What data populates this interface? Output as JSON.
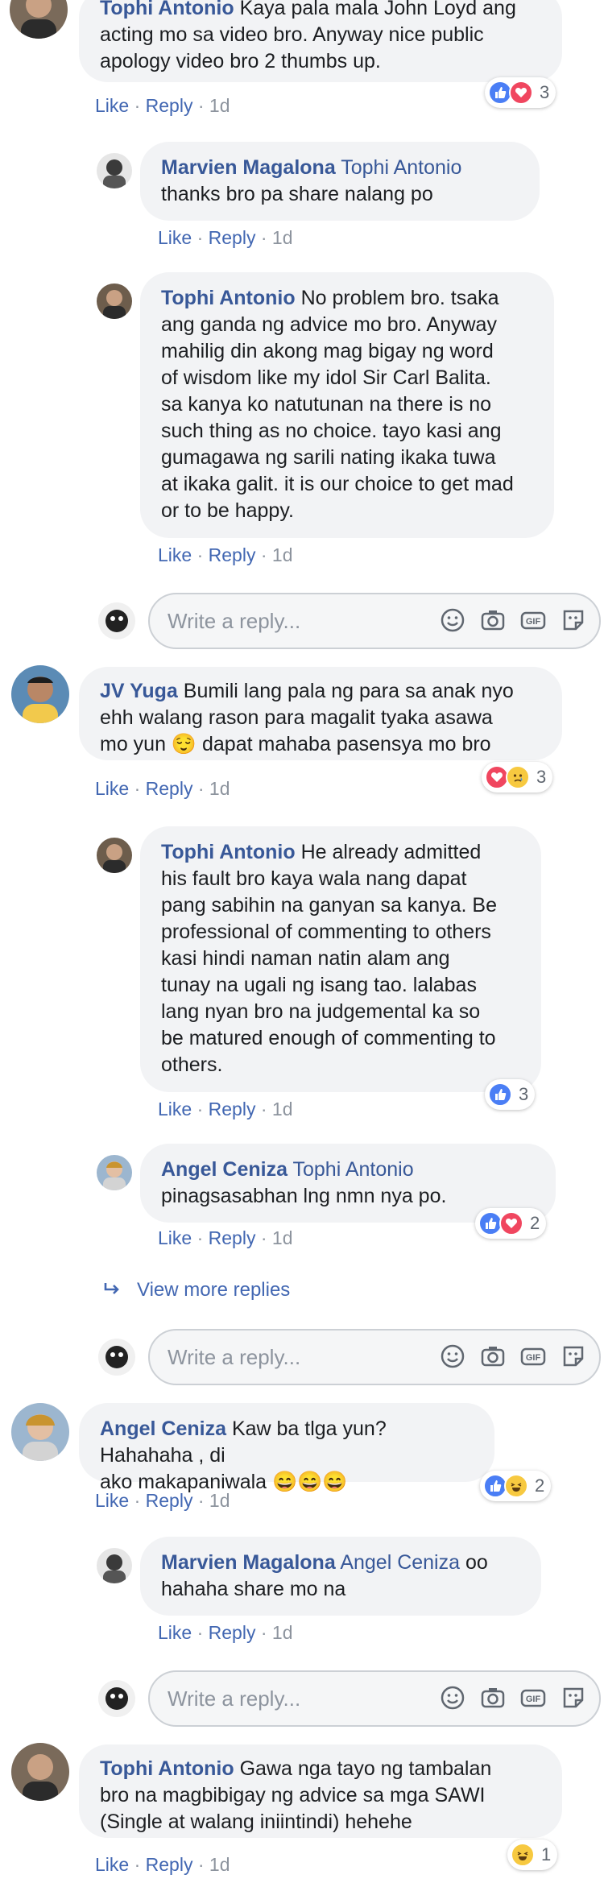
{
  "action_labels": {
    "like": "Like",
    "reply": "Reply",
    "sep": " · "
  },
  "reply_placeholder": "Write a reply...",
  "view_more_label": "View more replies",
  "comments": [
    {
      "name": "Tophi Antonio",
      "tag": "",
      "lines": [
        "Kaya pala mala John Loyd ang",
        "acting mo sa video bro. Anyway nice public",
        "apology video bro 2 thumbs up."
      ],
      "time": "1d",
      "reactions": [
        "like",
        "love"
      ],
      "reaction_count": "3"
    },
    {
      "name": "Marvien Magalona",
      "tag": "Tophi Antonio",
      "lines": [
        "thanks bro pa share nalang po"
      ],
      "time": "1d"
    },
    {
      "name": "Tophi Antonio",
      "tag": "",
      "lines": [
        "No problem bro. tsaka",
        "ang ganda ng advice mo bro. Anyway",
        "mahilig din akong mag bigay ng word",
        "of wisdom like my idol Sir Carl Balita.",
        "sa kanya ko natutunan na there is no",
        "such thing as no choice. tayo kasi ang",
        "gumagawa ng sarili nating ikaka tuwa",
        "at ikaka galit. it is our choice to get mad",
        "or to be happy."
      ],
      "time": "1d"
    },
    {
      "name": "JV Yuga",
      "tag": "",
      "lines": [
        "Bumili lang pala ng para sa anak nyo",
        "ehh walang rason para magalit tyaka asawa",
        "mo yun 😌 dapat mahaba pasensya mo bro"
      ],
      "time": "1d",
      "reactions": [
        "love",
        "sad"
      ],
      "reaction_count": "3"
    },
    {
      "name": "Tophi Antonio",
      "tag": "",
      "lines": [
        "He already admitted",
        "his fault bro kaya wala nang dapat",
        "pang sabihin na ganyan sa kanya. Be",
        "professional of commenting to others",
        "kasi hindi naman natin alam ang",
        "tunay na ugali ng isang tao. lalabas",
        "lang nyan bro na judgemental ka so",
        "be matured enough of commenting to",
        "others."
      ],
      "time": "1d",
      "reactions": [
        "like"
      ],
      "reaction_count": "3"
    },
    {
      "name": "Angel Ceniza",
      "tag": "Tophi Antonio",
      "lines": [
        "pinagsasabhan lng nmn nya po."
      ],
      "time": "1d",
      "reactions": [
        "like",
        "love"
      ],
      "reaction_count": "2"
    },
    {
      "name": "Angel Ceniza",
      "tag": "",
      "lines": [
        "Kaw ba tlga yun? Hahahaha , di",
        "ako makapaniwala 😄😄😄"
      ],
      "time": "1d",
      "reactions": [
        "like",
        "haha"
      ],
      "reaction_count": "2"
    },
    {
      "name": "Marvien Magalona",
      "tag": "Angel Ceniza",
      "lines": [
        "oo",
        "hahaha share mo na"
      ],
      "time": "1d"
    },
    {
      "name": "Tophi Antonio",
      "tag": "",
      "lines": [
        "Gawa nga tayo ng tambalan",
        "bro na magbibigay ng advice sa mga SAWI",
        "(Single at walang iniintindi) hehehe"
      ],
      "time": "1d",
      "reactions": [
        "haha"
      ],
      "reaction_count": "1"
    }
  ],
  "colors": {
    "link": "#385898",
    "action": "#4267b2",
    "meta": "#8d949e",
    "bubble": "#f2f3f5"
  }
}
